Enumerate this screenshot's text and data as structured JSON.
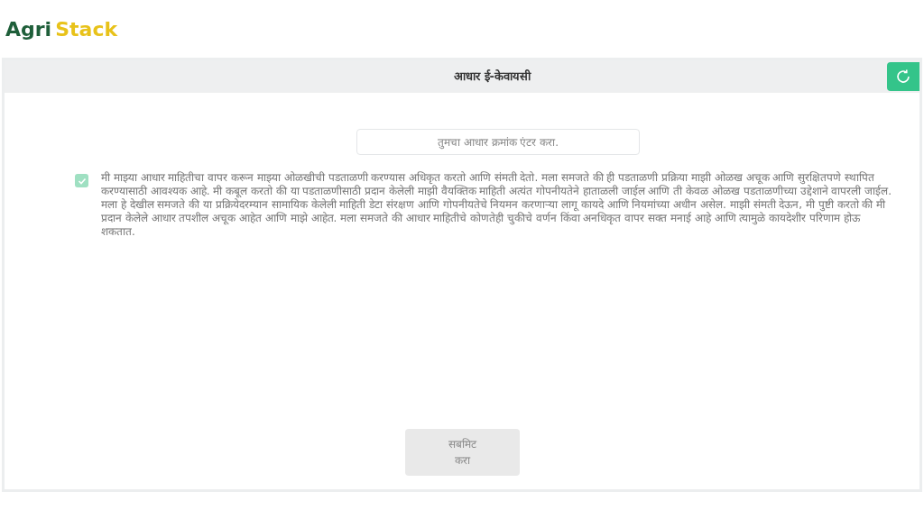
{
  "logo": {
    "part_1": "Agri",
    "part_2": "Stack"
  },
  "header": {
    "title": "आधार ई-केवायसी"
  },
  "aadhaar_field": {
    "placeholder": "तुमचा आधार क्रमांक एंटर करा."
  },
  "consent": {
    "checked": true,
    "text": "मी माझ्या आधार माहितीचा वापर करून माझ्या ओळखीची पडताळणी करण्यास अधिकृत करतो आणि संमती देतो. मला समजते की ही पडताळणी प्रक्रिया माझी ओळख अचूक आणि सुरक्षितपणे स्थापित करण्यासाठी आवश्यक आहे. मी कबूल करतो की या पडताळणीसाठी प्रदान केलेली माझी वैयक्तिक माहिती अत्यंत गोपनीयतेने हाताळली जाईल आणि ती केवळ ओळख पडताळणीच्या उद्देशाने वापरली जाईल. मला हे देखील समजते की या प्रक्रियेदरम्यान सामायिक केलेली माहिती डेटा संरक्षण आणि गोपनीयतेचे नियमन करणाऱ्या लागू कायदे आणि नियमांच्या अधीन असेल. माझी संमती देऊन, मी पुष्टी करतो की मी प्रदान केलेले आधार तपशील अचूक आहेत आणि माझे आहेत. मला समजते की आधार माहितीचे कोणतेही चुकीचे वर्णन किंवा अनधिकृत वापर सक्त मनाई आहे आणि त्यामुळे कायदेशीर परिणाम होऊ शकतात."
  },
  "submit_button": {
    "label": "सबमिट करा",
    "disabled": true
  }
}
